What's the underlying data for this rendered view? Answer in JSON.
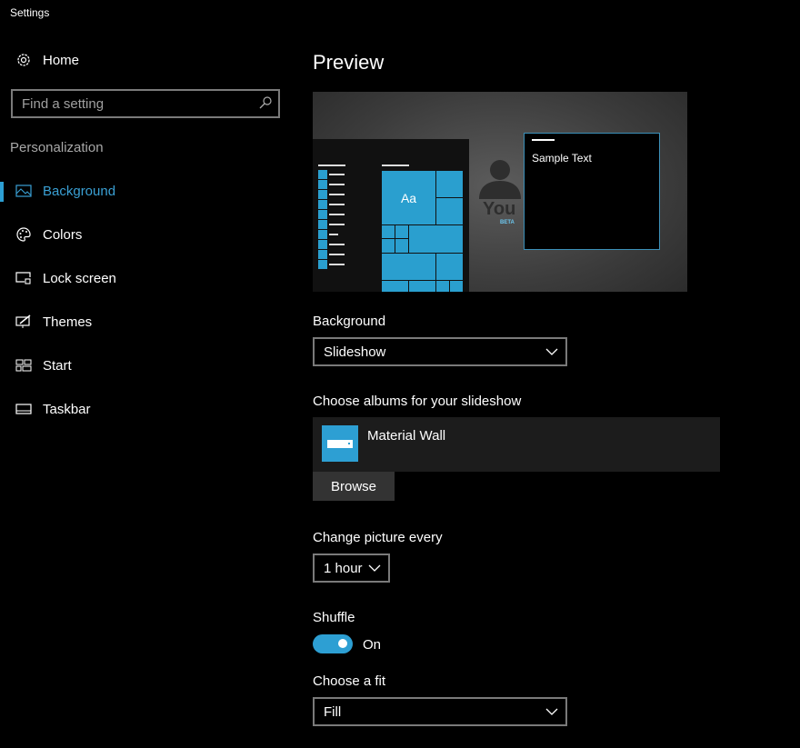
{
  "window": {
    "title": "Settings"
  },
  "sidebar": {
    "home": "Home",
    "search_placeholder": "Find a setting",
    "section": "Personalization",
    "items": [
      {
        "label": "Background",
        "icon": "picture-icon",
        "active": true
      },
      {
        "label": "Colors",
        "icon": "palette-icon"
      },
      {
        "label": "Lock screen",
        "icon": "lock-screen-icon"
      },
      {
        "label": "Themes",
        "icon": "themes-icon"
      },
      {
        "label": "Start",
        "icon": "start-icon"
      },
      {
        "label": "Taskbar",
        "icon": "taskbar-icon"
      }
    ]
  },
  "main": {
    "title": "Preview",
    "preview": {
      "tile_text": "Aa",
      "sample_text": "Sample Text",
      "logo_text": "You",
      "logo_badge": "BETA"
    },
    "background": {
      "label": "Background",
      "value": "Slideshow"
    },
    "albums": {
      "label": "Choose albums for your slideshow",
      "album_name": "Material Wall",
      "browse": "Browse"
    },
    "interval": {
      "label": "Change picture every",
      "value": "1 hour"
    },
    "shuffle": {
      "label": "Shuffle",
      "state": "On",
      "on": true
    },
    "fit": {
      "label": "Choose a fit",
      "value": "Fill"
    }
  },
  "colors": {
    "accent": "#2d9fd3",
    "background": "#000000"
  }
}
